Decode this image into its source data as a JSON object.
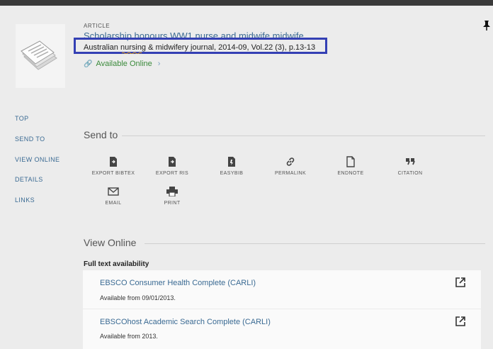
{
  "record": {
    "type": "ARTICLE",
    "title": "Scholarship honours WW1 nurse and midwife midwife",
    "source": "Australian nursing & midwifery journal, 2014-09, Vol.22 (3), p.13-13",
    "availability": "Available Online"
  },
  "sidenav": {
    "items": [
      {
        "label": "TOP"
      },
      {
        "label": "SEND TO"
      },
      {
        "label": "VIEW ONLINE"
      },
      {
        "label": "DETAILS"
      },
      {
        "label": "LINKS"
      }
    ]
  },
  "send_to": {
    "title": "Send to",
    "actions": [
      {
        "label": "EXPORT BIBTEX",
        "icon": "file-export-icon"
      },
      {
        "label": "EXPORT RIS",
        "icon": "file-export-icon"
      },
      {
        "label": "EASYBIB",
        "icon": "easybib-icon"
      },
      {
        "label": "PERMALINK",
        "icon": "link-icon"
      },
      {
        "label": "ENDNOTE",
        "icon": "document-icon"
      },
      {
        "label": "CITATION",
        "icon": "quote-icon"
      },
      {
        "label": "EMAIL",
        "icon": "email-icon"
      },
      {
        "label": "PRINT",
        "icon": "printer-icon"
      }
    ]
  },
  "view_online": {
    "title": "View Online",
    "fulltext_label": "Full text availability",
    "sources": [
      {
        "name": "EBSCO Consumer Health Complete (CARLI)",
        "availability": "Available from 09/01/2013."
      },
      {
        "name": "EBSCOhost Academic Search Complete (CARLI)",
        "availability": "Available from 2013."
      }
    ]
  },
  "colors": {
    "link": "#3a6a93",
    "available": "#3a8a3a",
    "highlight_border": "#3440b4",
    "background": "#ececec"
  }
}
